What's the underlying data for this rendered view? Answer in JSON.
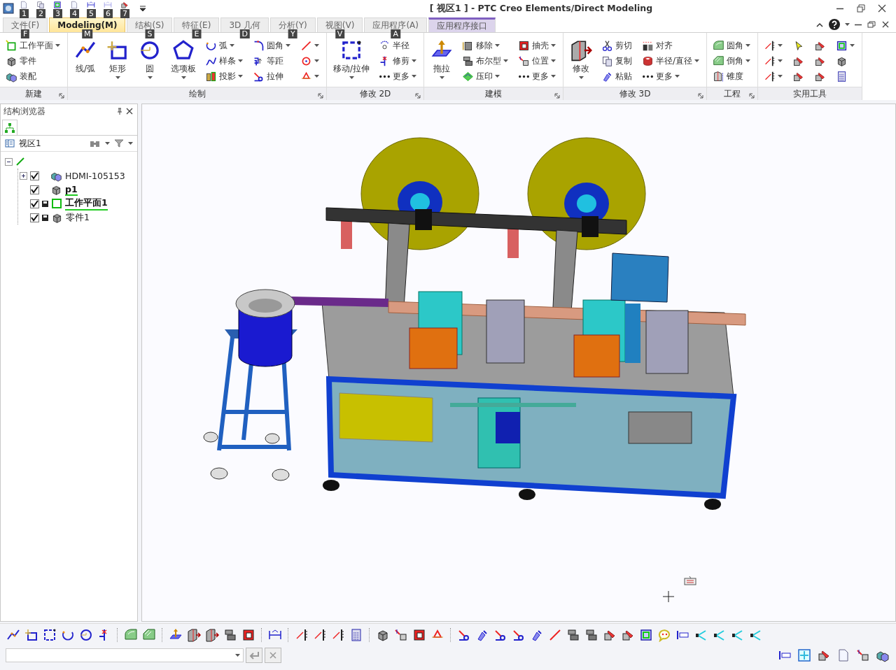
{
  "window": {
    "title": "[ 视区1 ] - PTC Creo Elements/Direct Modeling"
  },
  "quick_access": [
    {
      "keytip": "1",
      "disabled": false
    },
    {
      "keytip": "2",
      "disabled": false
    },
    {
      "keytip": "3",
      "disabled": false
    },
    {
      "keytip": "4",
      "disabled": false
    },
    {
      "keytip": "5",
      "disabled": false
    },
    {
      "keytip": "6",
      "disabled": true
    },
    {
      "keytip": "7",
      "disabled": false
    }
  ],
  "tabs": [
    {
      "label": "文件(F)",
      "keytip": "F",
      "selected": false,
      "kind": "file"
    },
    {
      "label": "Modeling(M)",
      "keytip": "M",
      "selected": true,
      "kind": "normal"
    },
    {
      "label": "结构(S)",
      "keytip": "S",
      "selected": false,
      "kind": "normal"
    },
    {
      "label": "特征(E)",
      "keytip": "E",
      "selected": false,
      "kind": "normal"
    },
    {
      "label": "3D 几何",
      "keytip": "D",
      "selected": false,
      "kind": "normal"
    },
    {
      "label": "分析(Y)",
      "keytip": "Y",
      "selected": false,
      "kind": "normal"
    },
    {
      "label": "视图(V)",
      "keytip": "V",
      "selected": false,
      "kind": "normal"
    },
    {
      "label": "应用程序(A)",
      "keytip": "A",
      "selected": false,
      "kind": "normal"
    },
    {
      "label": "应用程序接口",
      "selected": false,
      "kind": "contextual"
    }
  ],
  "ribbon": {
    "groups": [
      {
        "label": "新建",
        "launcher": true,
        "columns": [
          {
            "kind": "stack",
            "items": [
              {
                "label": "工作平面",
                "dropdown": true
              },
              {
                "label": "零件",
                "dropdown": false
              },
              {
                "label": "装配",
                "dropdown": false
              }
            ]
          }
        ]
      },
      {
        "label": "绘制",
        "launcher": true,
        "columns": [
          {
            "kind": "large",
            "label": "线/弧",
            "dropdown": false
          },
          {
            "kind": "large",
            "label": "矩形",
            "dropdown": true
          },
          {
            "kind": "large",
            "label": "圆",
            "dropdown": true
          },
          {
            "kind": "large",
            "label": "选项板",
            "dropdown": true
          },
          {
            "kind": "stack",
            "items": [
              {
                "label": "弧",
                "dropdown": true
              },
              {
                "label": "样条",
                "dropdown": true
              },
              {
                "label": "投影",
                "dropdown": true
              }
            ]
          },
          {
            "kind": "stack",
            "items": [
              {
                "label": "圆角",
                "dropdown": true
              },
              {
                "label": "等距",
                "dropdown": false
              },
              {
                "label": "拉伸",
                "dropdown": false
              }
            ]
          },
          {
            "kind": "stack",
            "items": [
              {
                "dropdown": true
              },
              {
                "dropdown": true
              },
              {
                "dropdown": true
              }
            ]
          }
        ]
      },
      {
        "label": "修改 2D",
        "launcher": true,
        "columns": [
          {
            "kind": "large",
            "label": "移动/拉伸",
            "dropdown": true
          },
          {
            "kind": "stack",
            "items": [
              {
                "label": "半径",
                "dropdown": false
              },
              {
                "label": "修剪",
                "dropdown": true
              },
              {
                "label": "更多",
                "dropdown": true
              }
            ]
          }
        ]
      },
      {
        "label": "建模",
        "launcher": true,
        "columns": [
          {
            "kind": "large",
            "label": "拖拉",
            "dropdown": true
          },
          {
            "kind": "stack",
            "items": [
              {
                "label": "移除",
                "dropdown": true
              },
              {
                "label": "布尔型",
                "dropdown": true
              },
              {
                "label": "压印",
                "dropdown": true
              }
            ]
          },
          {
            "kind": "stack",
            "items": [
              {
                "label": "抽壳",
                "dropdown": true
              },
              {
                "label": "位置",
                "dropdown": true
              },
              {
                "label": "更多",
                "dropdown": true
              }
            ]
          }
        ]
      },
      {
        "label": "修改 3D",
        "launcher": true,
        "columns": [
          {
            "kind": "large",
            "label": "修改",
            "dropdown": true
          },
          {
            "kind": "stack",
            "items": [
              {
                "label": "剪切",
                "dropdown": false
              },
              {
                "label": "复制",
                "dropdown": false
              },
              {
                "label": "粘贴",
                "dropdown": false
              }
            ]
          },
          {
            "kind": "stack",
            "items": [
              {
                "label": "对齐",
                "dropdown": false
              },
              {
                "label": "半径/直径",
                "dropdown": true
              },
              {
                "label": "更多",
                "dropdown": true
              }
            ]
          }
        ]
      },
      {
        "label": "工程",
        "launcher": true,
        "columns": [
          {
            "kind": "stack",
            "items": [
              {
                "label": "圆角",
                "dropdown": true
              },
              {
                "label": "倒角",
                "dropdown": true
              },
              {
                "label": "锥度",
                "dropdown": false
              }
            ]
          }
        ]
      },
      {
        "label": "实用工具",
        "launcher": false,
        "columns": [
          {
            "kind": "stack",
            "items": [
              {
                "dropdown": true
              },
              {
                "dropdown": true
              },
              {
                "dropdown": true
              }
            ]
          },
          {
            "kind": "stack",
            "items": [
              {
                "dropdown": false
              },
              {
                "dropdown": false
              },
              {
                "dropdown": false
              }
            ]
          },
          {
            "kind": "stack",
            "items": [
              {
                "dropdown": false
              },
              {
                "dropdown": false
              },
              {
                "dropdown": false
              }
            ]
          },
          {
            "kind": "stack",
            "items": [
              {
                "dropdown": true
              },
              {
                "dropdown": false
              },
              {
                "dropdown": false
              }
            ]
          }
        ]
      }
    ]
  },
  "browser": {
    "title": "结构浏览器",
    "view": "视区1",
    "tree": [
      {
        "kind": "root",
        "expanded": true,
        "children": [
          {
            "label": "HDMI-105153",
            "kind": "assembly",
            "checked": true,
            "expanded": false,
            "active": false,
            "modified": false
          },
          {
            "label": "p1",
            "kind": "part",
            "checked": true,
            "active": true,
            "modified": false
          },
          {
            "label": "工作平面1",
            "kind": "workplane",
            "checked": true,
            "active": true,
            "modified": true
          },
          {
            "label": "零件1",
            "kind": "part",
            "checked": true,
            "active": false,
            "modified": true
          }
        ]
      }
    ]
  }
}
